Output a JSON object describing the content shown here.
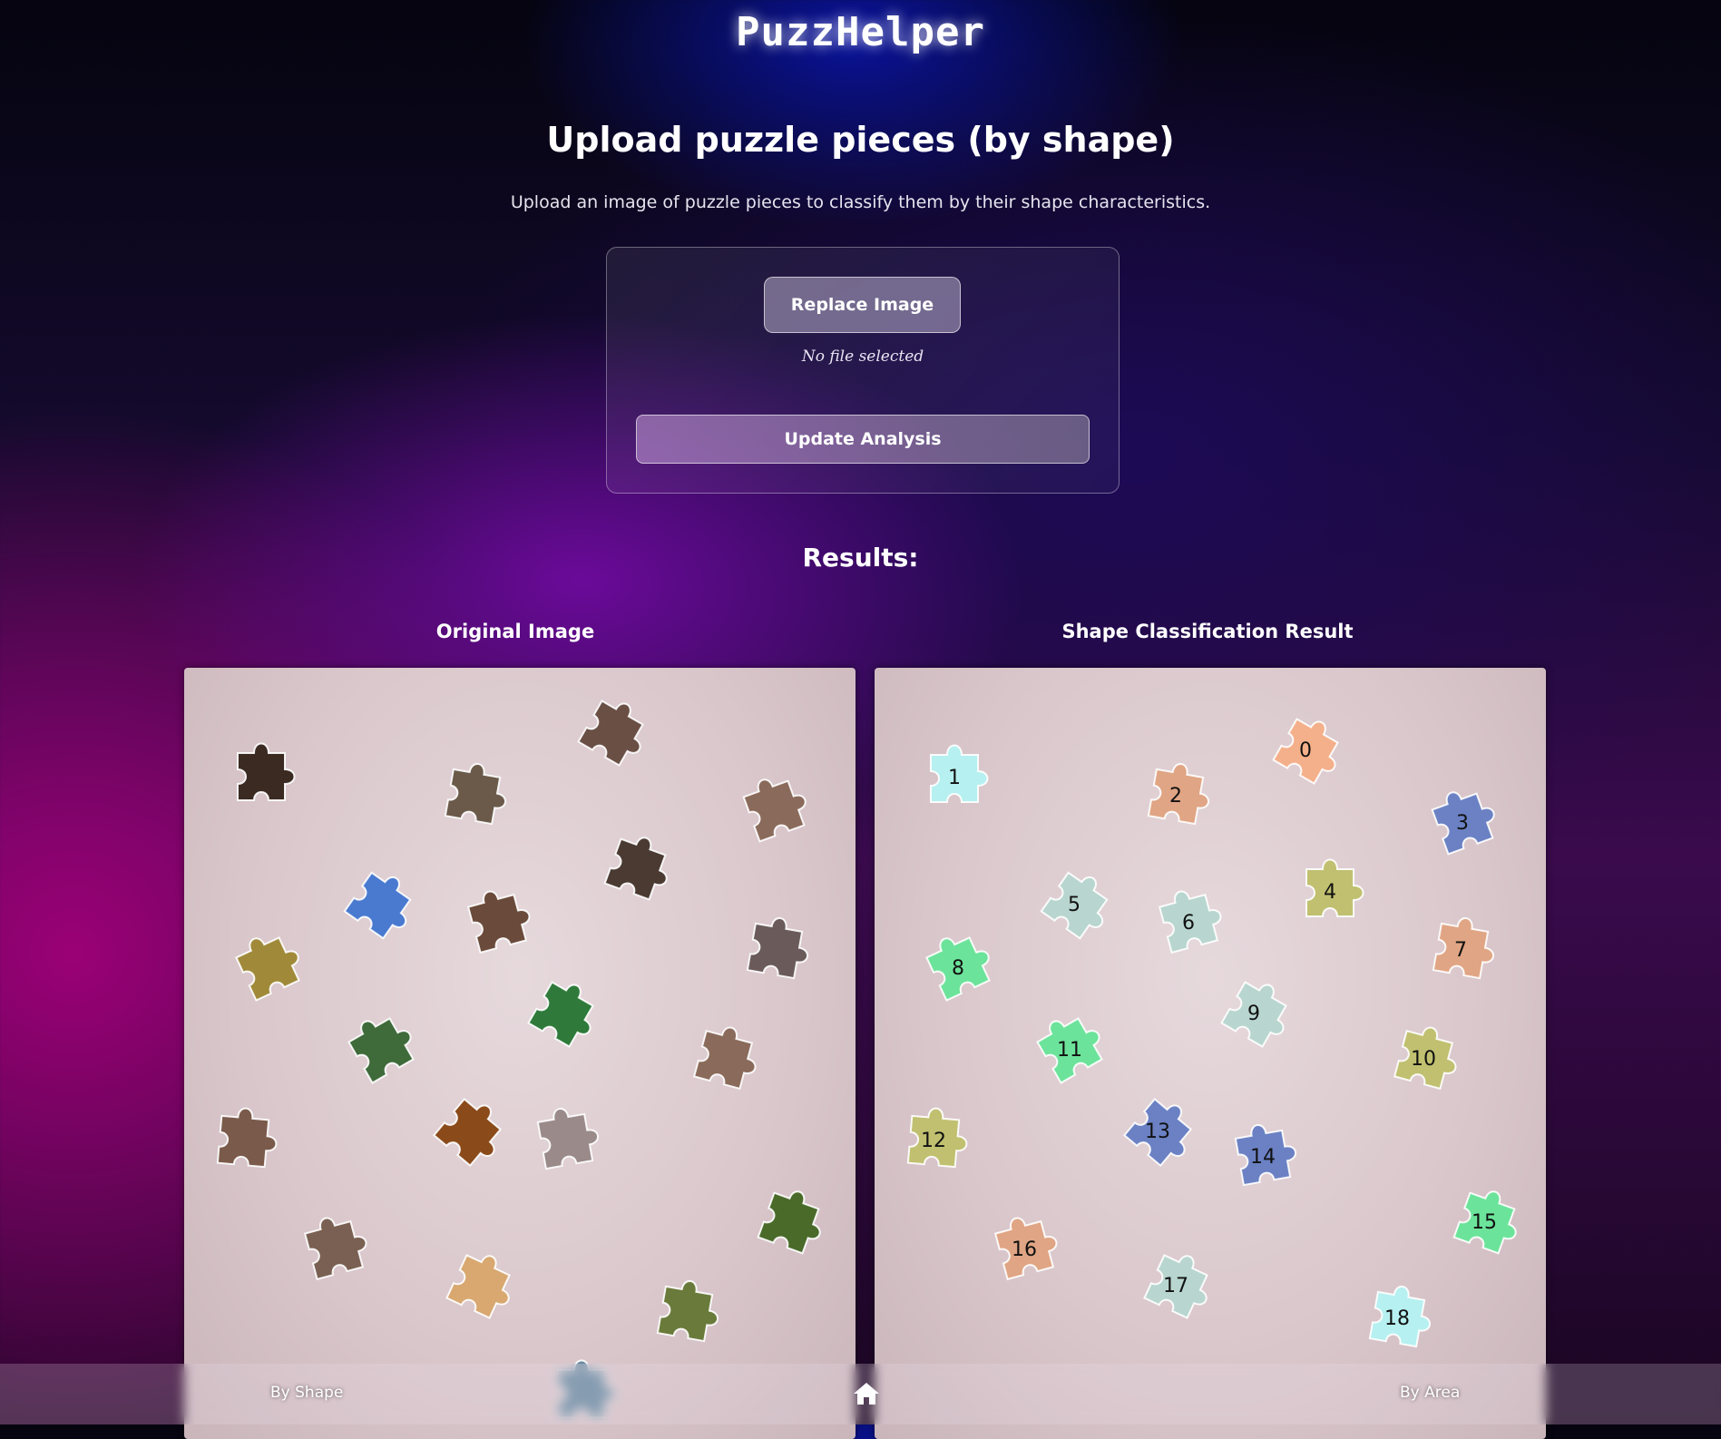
{
  "app": {
    "logo_text": "PuzzHelper"
  },
  "page": {
    "title": "Upload puzzle pieces (by shape)",
    "subtitle": "Upload an image of puzzle pieces to classify them by their shape characteristics."
  },
  "upload": {
    "replace_label": "Replace Image",
    "file_status": "No file selected",
    "update_label": "Update Analysis"
  },
  "results": {
    "heading": "Results:",
    "original_title": "Original Image",
    "classified_title": "Shape Classification Result"
  },
  "original_pieces": [
    {
      "color": "#3b2a22"
    },
    {
      "color": "#6b5a4a"
    },
    {
      "color": "#6a4f45"
    },
    {
      "color": "#8a6a5a"
    },
    {
      "color": "#4a7ad0"
    },
    {
      "color": "#6a4a3a"
    },
    {
      "color": "#4a3a32"
    },
    {
      "color": "#a08a3a"
    },
    {
      "color": "#6a5a5a"
    },
    {
      "color": "#2f7a3a"
    },
    {
      "color": "#3f6a3a"
    },
    {
      "color": "#8a6a5a"
    },
    {
      "color": "#7a5a4a"
    },
    {
      "color": "#8a4a1a"
    },
    {
      "color": "#9a8a8a"
    },
    {
      "color": "#4a6a2a"
    },
    {
      "color": "#7a6052"
    },
    {
      "color": "#d8a870"
    },
    {
      "color": "#6a7a3a"
    },
    {
      "color": "#6a8aa0"
    }
  ],
  "classified_pieces": [
    {
      "id": "0",
      "color": "#f4b08a"
    },
    {
      "id": "1",
      "color": "#b6f0f0"
    },
    {
      "id": "2",
      "color": "#e0a584"
    },
    {
      "id": "3",
      "color": "#6b81c4"
    },
    {
      "id": "4",
      "color": "#c0c070"
    },
    {
      "id": "5",
      "color": "#b8d6cf"
    },
    {
      "id": "6",
      "color": "#b8d6cf"
    },
    {
      "id": "7",
      "color": "#e0a584"
    },
    {
      "id": "8",
      "color": "#6ce39a"
    },
    {
      "id": "9",
      "color": "#b8d6cf"
    },
    {
      "id": "10",
      "color": "#c0c070"
    },
    {
      "id": "11",
      "color": "#6ce39a"
    },
    {
      "id": "12",
      "color": "#c0c070"
    },
    {
      "id": "13",
      "color": "#6b81c4"
    },
    {
      "id": "14",
      "color": "#6b81c4"
    },
    {
      "id": "15",
      "color": "#6ce39a"
    },
    {
      "id": "16",
      "color": "#e0a584"
    },
    {
      "id": "17",
      "color": "#b8d6cf"
    },
    {
      "id": "18",
      "color": "#b6f0f0"
    }
  ],
  "nav": {
    "left_label": "By Shape",
    "home_icon": "home-icon",
    "right_label": "By Area"
  }
}
